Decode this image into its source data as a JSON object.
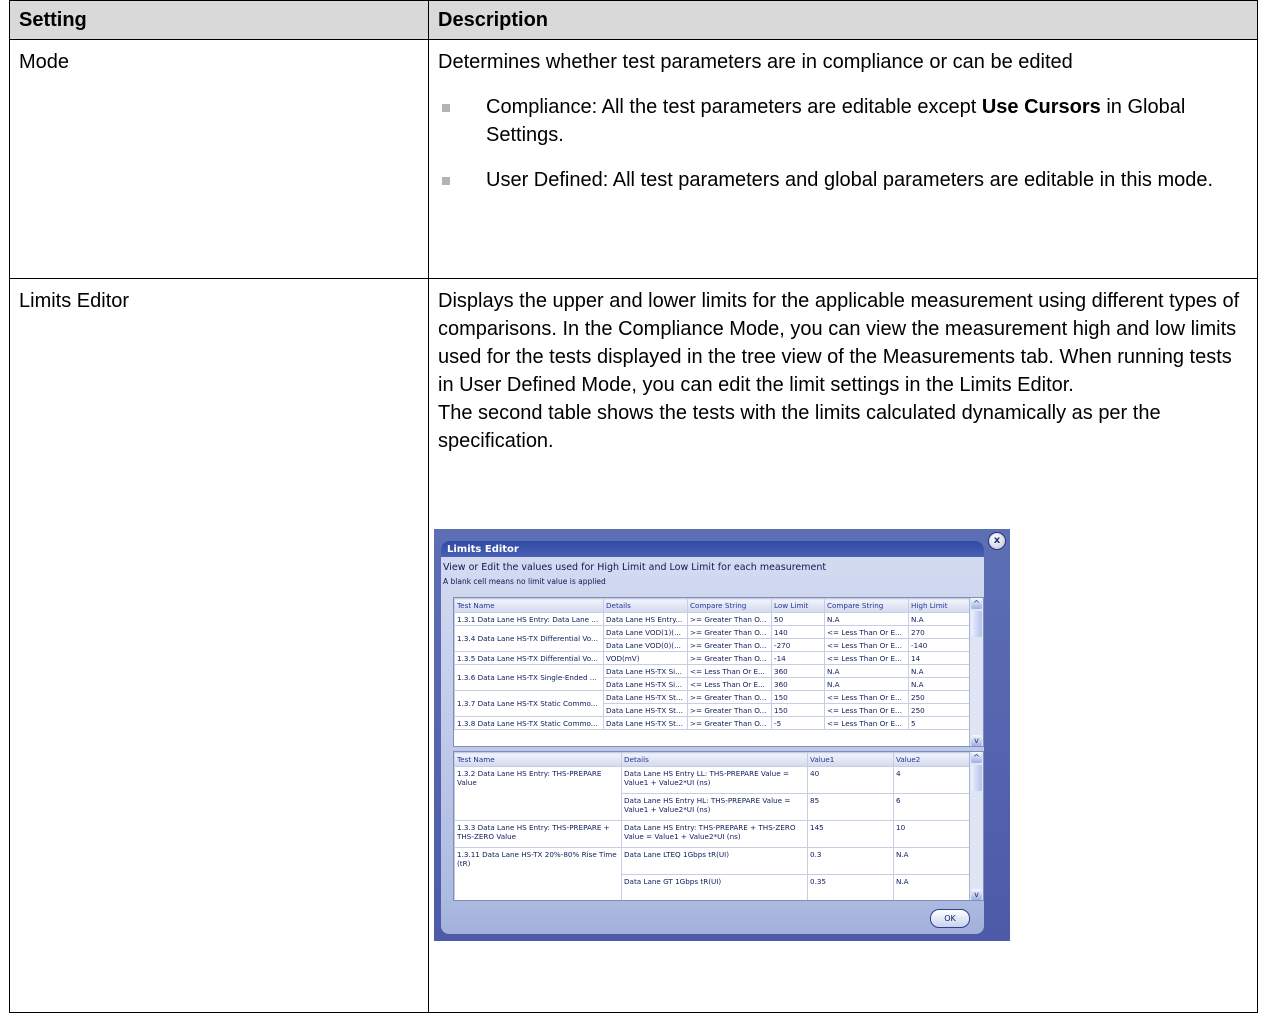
{
  "table": {
    "headers": [
      "Setting",
      "Description"
    ],
    "mode": {
      "setting": "Mode",
      "intro": "Determines whether test parameters are in compliance or can be edited",
      "bullet1_pre": "Compliance: All the test parameters are editable except ",
      "bullet1_bold": "Use Cursors",
      "bullet1_post": " in Global Settings.",
      "bullet2": "User Defined: All test parameters and global parameters are editable in this mode."
    },
    "limits": {
      "setting": "Limits Editor",
      "para1": "Displays the upper and lower limits for the applicable measurement using different types of comparisons. In the Compliance Mode, you can view the measurement high and low limits used for the tests displayed in the tree view of the Measurements tab. When running tests in User Defined Mode, you can edit the limit settings in the Limits Editor.",
      "para2": "The second table shows the tests with the limits calculated dynamically as per the specification."
    }
  },
  "dialog": {
    "title": "Limits Editor",
    "subtitle": "View or Edit the values used for High  Limit and Low Limit for each measurement",
    "note": "A blank cell means no limit value is applied",
    "close_label": "x",
    "ok_label": "OK",
    "grid1": {
      "headers": [
        "Test Name",
        "Details",
        "Compare String",
        "Low Limit",
        "Compare String",
        "High Limit"
      ],
      "rows": [
        [
          "1.3.1 Data Lane HS Entry: Data Lane ...",
          "Data Lane HS Entry...",
          ">= Greater Than O...",
          "50",
          "N.A",
          "N.A"
        ],
        [
          "1.3.4 Data Lane HS-TX Differential Vo...",
          "Data Lane VOD(1)(...",
          ">= Greater Than O...",
          "140",
          "<= Less Than Or E...",
          "270"
        ],
        [
          "",
          "Data Lane VOD(0)(...",
          ">= Greater Than O...",
          "-270",
          "<= Less Than Or E...",
          "-140"
        ],
        [
          "1.3.5 Data Lane HS-TX Differential Vo...",
          "VOD(mV)",
          ">= Greater Than O...",
          "-14",
          "<= Less Than Or E...",
          "14"
        ],
        [
          "1.3.6 Data Lane HS-TX Single-Ended ...",
          "Data Lane HS-TX Si...",
          "<= Less Than Or E...",
          "360",
          "N.A",
          "N.A"
        ],
        [
          "",
          "Data Lane HS-TX Si...",
          "<= Less Than Or E...",
          "360",
          "N.A",
          "N.A"
        ],
        [
          "1.3.7 Data Lane HS-TX Static Commo...",
          "Data Lane HS-TX St...",
          ">= Greater Than O...",
          "150",
          "<= Less Than Or E...",
          "250"
        ],
        [
          "",
          "Data Lane HS-TX St...",
          ">= Greater Than O...",
          "150",
          "<= Less Than Or E...",
          "250"
        ],
        [
          "1.3.8 Data Lane HS-TX Static Commo...",
          "Data Lane HS-TX St...",
          ">= Greater Than O...",
          "-5",
          "<= Less Than Or E...",
          "5"
        ]
      ]
    },
    "grid2": {
      "headers": [
        "Test Name",
        "Details",
        "Value1",
        "Value2"
      ],
      "rows": [
        [
          "1.3.2 Data Lane HS Entry: THS-PREPARE Value",
          "Data Lane HS Entry LL: THS-PREPARE Value = Value1 + Value2*UI (ns)",
          "40",
          "4"
        ],
        [
          "",
          "Data Lane HS Entry HL: THS-PREPARE Value = Value1 + Value2*UI (ns)",
          "85",
          "6"
        ],
        [
          "1.3.3 Data Lane HS Entry: THS-PREPARE + THS-ZERO Value",
          "Data Lane HS Entry: THS-PREPARE + THS-ZERO Value = Value1 + Value2*UI (ns)",
          "145",
          "10"
        ],
        [
          "1.3.11 Data Lane HS-TX 20%-80% Rise Time (tR)",
          "Data Lane LTEQ 1Gbps tR(UI)",
          "0.3",
          "N.A"
        ],
        [
          "",
          "Data Lane GT 1Gbps tR(UI)",
          "0.35",
          "N.A"
        ]
      ]
    }
  }
}
